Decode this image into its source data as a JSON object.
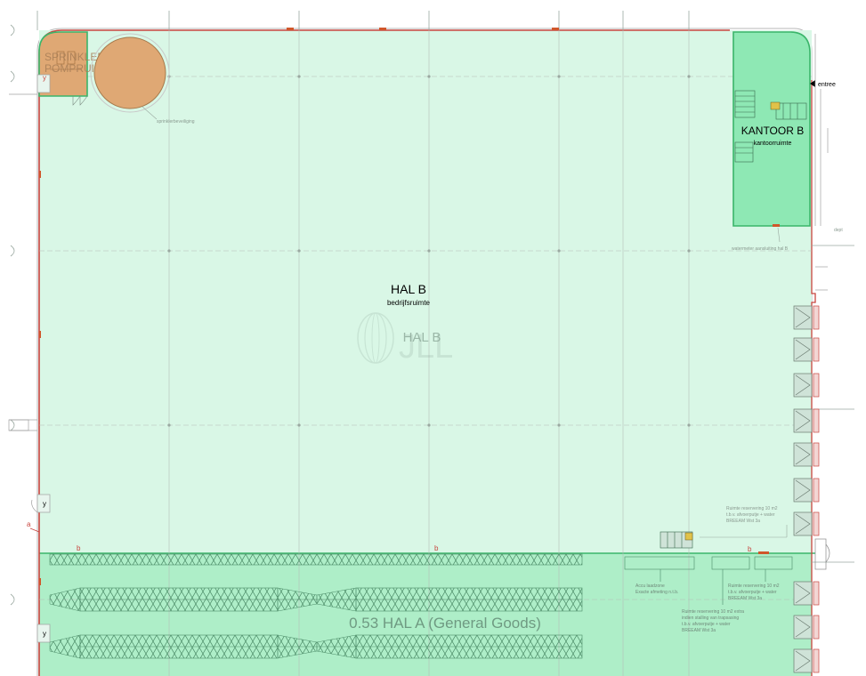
{
  "plan": {
    "hal_b": {
      "title": "HAL B",
      "subtitle": "bedrijfsruimte",
      "watermark_label": "HAL B"
    },
    "kantoor_b": {
      "title": "KANTOOR B",
      "subtitle": "kantoorruimte"
    },
    "sprinkler": {
      "line1": "SPRINKLER",
      "line2": "POMPRUIMTE"
    },
    "annotations": {
      "sprinkler_tank": "sprinklerbeveiliging",
      "entrance": "entree",
      "watermeter": "watermeter aansluiting hal B",
      "dock": "dept",
      "ruimte_1": [
        "Ruimte reservering 10 m2",
        "t.b.v. afvoerputje + water",
        "BREEAM Wst 3a"
      ],
      "ruimte_2": [
        "Ruimte reservering 10 m2",
        "t.b.v. afvoerputje + water",
        "BREEAM Wst 3a"
      ],
      "ruimte_3": [
        "Ruimte reservering 10 m2 extra",
        "indien stalling van trapsasing",
        "t.b.v. afvoerputje + water",
        "BREEAM Wst 3a"
      ],
      "accu": [
        "Accu laadzone",
        "Exacte afmeting n.t.b."
      ]
    },
    "hal_a": {
      "label": "0.53 HAL A (General Goods)"
    },
    "markers": {
      "y": "y",
      "a": "a",
      "b": "b"
    },
    "watermark": "JLL",
    "colors": {
      "hall_fill": "#d9f7e6",
      "hall_a_fill": "#aeeec8",
      "office_fill": "#8ee8b4",
      "sprinkler_fill": "#dfa874",
      "wall_red": "#c8453f",
      "green_line": "#3ab56a",
      "grid": "#9aa8a0"
    }
  }
}
